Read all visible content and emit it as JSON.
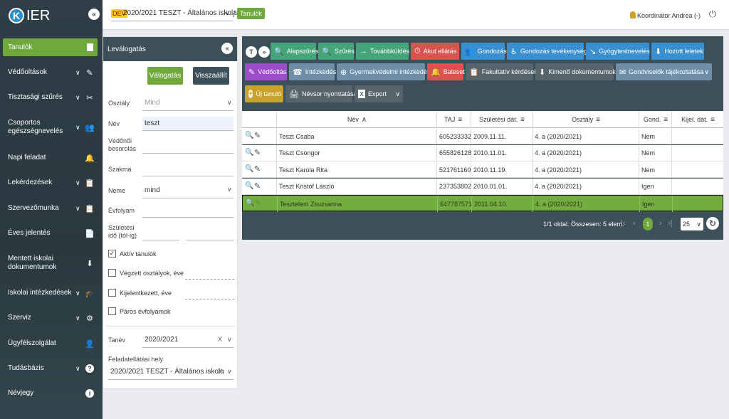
{
  "sidebar": {
    "logo_letter": "K",
    "logo_text": "IER",
    "collapse_icon": "«",
    "items": [
      {
        "label": "Tanulók",
        "chevron": "",
        "icon": "▮"
      },
      {
        "label": "Védőoltások",
        "chevron": "∨",
        "icon": "✎"
      },
      {
        "label": "Tisztasági szűrés",
        "chevron": "∨",
        "icon": "✂"
      },
      {
        "label": "Csoportos egészségnevelés",
        "chevron": "∨",
        "icon": "👥"
      },
      {
        "label": "Napi feladat",
        "chevron": "",
        "icon": "🔔"
      },
      {
        "label": "Lekérdezések",
        "chevron": "∨",
        "icon": "📋"
      },
      {
        "label": "Szervezőmunka",
        "chevron": "∨",
        "icon": "📋"
      },
      {
        "label": "Éves jelentés",
        "chevron": "",
        "icon": "📄"
      },
      {
        "label": "Mentett iskolai dokumentumok",
        "chevron": "",
        "icon": "⬇"
      },
      {
        "label": "Iskolai intézkedések",
        "chevron": "∨",
        "icon": "🎓"
      },
      {
        "label": "Szerviz",
        "chevron": "∨",
        "icon": "⚙"
      },
      {
        "label": "Ügyfélszolgálat",
        "chevron": "",
        "icon": "👤"
      },
      {
        "label": "Tudásbázis",
        "chevron": "∨",
        "icon": "?"
      },
      {
        "label": "Névjegy",
        "chevron": "",
        "icon": "i"
      }
    ]
  },
  "topbar": {
    "dev_badge": "DEV",
    "school": "2020/2021 TESZT - Általános iskola",
    "school_chevron": "∨",
    "slash": "/",
    "crumb": "Tanulók",
    "user": "Koordinátor Andrea (-)",
    "power_icon": "⏻"
  },
  "filter": {
    "title": "Leválogatás",
    "collapse": "«",
    "select_btn": "Válogatás",
    "reset_btn": "Visszaállít",
    "class_label": "Osztály",
    "class_value": "Mind",
    "name_label": "Név",
    "name_value": "teszt",
    "nurse_label": "Védőnői besorolás",
    "profession_label": "Szakma",
    "gender_label": "Neme",
    "gender_value": "mind",
    "grade_label": "Évfolyam",
    "birth_label": "Születési idő (tól-ig)",
    "chk_active": "Aktív tanulók",
    "chk_active_mark": "✓",
    "chk_graduated": "Végzett osztályok, éve",
    "chk_deregistered": "Kijelentkezett, éve",
    "chk_even": "Páros évfolyamok",
    "year_label": "Tanév",
    "year_value": "2020/2021",
    "clear": "X",
    "chevron": "∨",
    "site_label": "Feladatellátási hely",
    "site_value": "2020/2021 TESZT - Általános iskola"
  },
  "toolbar": {
    "filter_icon": "T",
    "collapse_icon": "»",
    "row1": [
      {
        "label": "Alapszűrés",
        "icon": "🔍"
      },
      {
        "label": "Szűrés",
        "icon": "🔍"
      },
      {
        "label": "Továbbküldés",
        "icon": "→"
      },
      {
        "label": "Akut ellátás",
        "icon": "⏱"
      },
      {
        "label": "Gondozás",
        "icon": "👥"
      },
      {
        "label": "Gondozás tevékenység",
        "icon": "♿"
      },
      {
        "label": "Gyógytestnevelés",
        "icon": "↘"
      },
      {
        "label": "Hozott leletek",
        "icon": "⬇"
      }
    ],
    "row2": [
      {
        "label": "Védőoltás",
        "icon": "✎"
      },
      {
        "label": "Intézkedés",
        "icon": "☎"
      },
      {
        "label": "Gyermekvédelmi intézkedés",
        "icon": "⊕"
      },
      {
        "label": "Baleset",
        "icon": "🔔"
      },
      {
        "label": "Fakultatív kérdések",
        "icon": "📋"
      },
      {
        "label": "Kimenő dokumentumok",
        "icon": "⬇"
      },
      {
        "label": "Gondviselők tájékoztatása",
        "icon": "✉"
      }
    ],
    "row2_chevron": "∨",
    "row3": [
      {
        "label": "Új tanuló",
        "icon": "+"
      },
      {
        "label": "Névsor nyomtatása",
        "icon": "🖨"
      },
      {
        "label": "Export",
        "icon": "X"
      }
    ],
    "row3_chevron": "∨"
  },
  "table": {
    "columns": [
      "Név",
      "TAJ",
      "Születési dát.",
      "Osztály",
      "Gond.",
      "Kijel. dát."
    ],
    "name_sort_icon": "∧",
    "sort_icon": "≡",
    "search_icon": "🔍",
    "edit_icon": "✎",
    "rows": [
      {
        "name": "Teszt Csaba",
        "taj": "605233332",
        "birth": "2009.11.11.",
        "class": "4. a (2020/2021)",
        "gond": "Nem",
        "kijel": ""
      },
      {
        "name": "Teszt Csongor",
        "taj": "655826128",
        "birth": "2010.11.01.",
        "class": "4. a (2020/2021)",
        "gond": "Nem",
        "kijel": ""
      },
      {
        "name": "Teszt Karola Rita",
        "taj": "521761160",
        "birth": "2010.11.19.",
        "class": "4. a (2020/2021)",
        "gond": "Nem",
        "kijel": ""
      },
      {
        "name": "Teszt Kristóf László",
        "taj": "237353802",
        "birth": "2010.01.01.",
        "class": "4. a (2020/2021)",
        "gond": "Igen",
        "kijel": ""
      },
      {
        "name": "Tesztelem Zsuzsanna",
        "taj": "647787571",
        "birth": "2011.04.10.",
        "class": "4. a (2020/2021)",
        "gond": "Igen",
        "kijel": ""
      }
    ],
    "selected_row": 4
  },
  "pager": {
    "summary": "1/1 oldal. Összesen: 5 elem.",
    "first": "|‹",
    "prev": "‹",
    "current": "1",
    "next": "›",
    "last": "›|",
    "page_size": "25",
    "page_size_chevron": "∨",
    "refresh_icon": "↻"
  },
  "colors": {
    "sidebar_bg": "#2f3e47",
    "accent_green": "#6fa83b",
    "panel_dark": "#3d5059",
    "btn_teal": "#46a47a",
    "btn_red": "#d9534f",
    "btn_blue": "#3a8fcf",
    "btn_purple": "#9b4dca"
  }
}
